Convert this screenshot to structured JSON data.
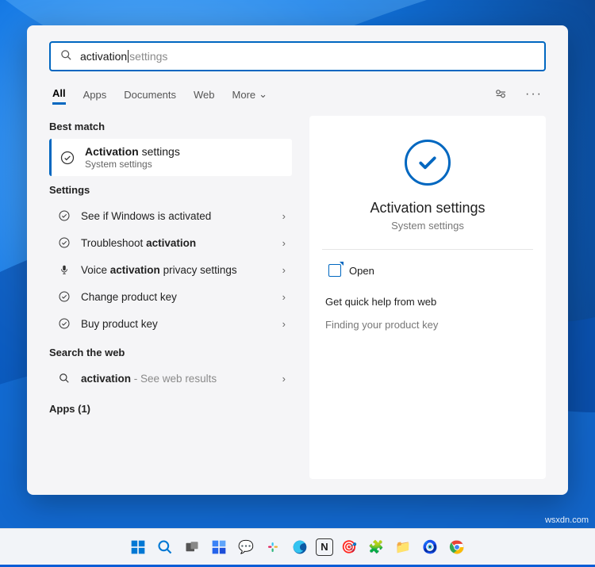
{
  "search": {
    "typed": "activation",
    "ghost": "settings"
  },
  "tabs": {
    "all": "All",
    "apps": "Apps",
    "documents": "Documents",
    "web": "Web",
    "more": "More"
  },
  "sections": {
    "best": "Best match",
    "settings": "Settings",
    "web": "Search the web",
    "apps": "Apps (1)"
  },
  "best": {
    "title_pre": "Activation",
    "title_post": " settings",
    "sub": "System settings"
  },
  "settings_rows": [
    {
      "label": "See if Windows is activated"
    },
    {
      "label_pre": "Troubleshoot ",
      "bold": "activation"
    },
    {
      "label_pre": "Voice ",
      "bold": "activation",
      "label_post": " privacy settings",
      "icon": "mic"
    },
    {
      "label": "Change product key"
    },
    {
      "label": "Buy product key"
    }
  ],
  "web_row": {
    "bold": "activation",
    "suffix": " - See web results"
  },
  "hero": {
    "title": "Activation settings",
    "sub": "System settings"
  },
  "open": "Open",
  "quickhelp": {
    "header": "Get quick help from web",
    "link1": "Finding your product key"
  },
  "watermark": "wsxdn.com"
}
